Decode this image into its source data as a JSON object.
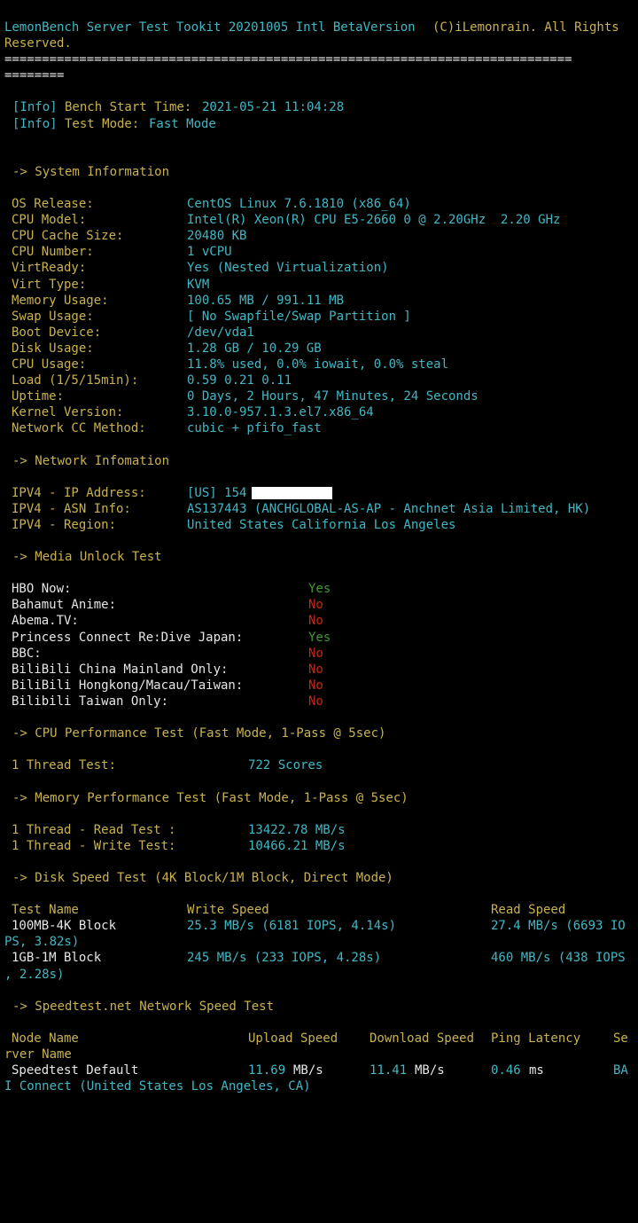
{
  "header": {
    "title": "LemonBench Server Test Tookit 20201005 Intl BetaVersion",
    "copyright_line1": "(C)iLemonrain. All Rights",
    "copyright_line2": "Reserved.",
    "separator1": "============================================================================",
    "separator2": "========"
  },
  "info": {
    "tag": "[Info]",
    "start_label": "Bench Start Time:",
    "start_value": "2021-05-21 11:04:28",
    "mode_label": "Test Mode:",
    "mode_value": "Fast Mode"
  },
  "system": {
    "heading": "-> System Information",
    "rows": [
      {
        "label": "OS Release:",
        "value": "CentOS Linux 7.6.1810 (x86_64)"
      },
      {
        "label": "CPU Model:",
        "value": "Intel(R) Xeon(R) CPU E5-2660 0 @ 2.20GHz  2.20 GHz"
      },
      {
        "label": "CPU Cache Size:",
        "value": "20480 KB"
      },
      {
        "label": "CPU Number:",
        "value": "1 vCPU"
      },
      {
        "label": "VirtReady:",
        "value": "Yes (Nested Virtualization)"
      },
      {
        "label": "Virt Type:",
        "value": "KVM"
      },
      {
        "label": "Memory Usage:",
        "value": "100.65 MB / 991.11 MB"
      },
      {
        "label": "Swap Usage:",
        "value": "[ No Swapfile/Swap Partition ]"
      },
      {
        "label": "Boot Device:",
        "value": "/dev/vda1"
      },
      {
        "label": "Disk Usage:",
        "value": "1.28 GB / 10.29 GB"
      },
      {
        "label": "CPU Usage:",
        "value": "11.8% used, 0.0% iowait, 0.0% steal"
      },
      {
        "label": "Load (1/5/15min):",
        "value": "0.59 0.21 0.11"
      },
      {
        "label": "Uptime:",
        "value": "0 Days, 2 Hours, 47 Minutes, 24 Seconds"
      },
      {
        "label": "Kernel Version:",
        "value": "3.10.0-957.1.3.el7.x86_64"
      },
      {
        "label": "Network CC Method:",
        "value": "cubic + pfifo_fast"
      }
    ]
  },
  "network": {
    "heading": "-> Network Infomation",
    "rows": [
      {
        "label": "IPV4 - IP Address:",
        "value": "[US] 154"
      },
      {
        "label": "IPV4 - ASN Info:",
        "value": "AS137443 (ANCHGLOBAL-AS-AP - Anchnet Asia Limited, HK)"
      },
      {
        "label": "IPV4 - Region:",
        "value": "United States California Los Angeles"
      }
    ]
  },
  "media": {
    "heading": "-> Media Unlock Test",
    "rows": [
      {
        "label": "HBO Now:",
        "value": "Yes",
        "color": "#3d9a2d"
      },
      {
        "label": "Bahamut Anime:",
        "value": "No",
        "color": "#c4281c"
      },
      {
        "label": "Abema.TV:",
        "value": "No",
        "color": "#c4281c"
      },
      {
        "label": "Princess Connect Re:Dive Japan:",
        "value": "Yes",
        "color": "#3d9a2d"
      },
      {
        "label": "BBC:",
        "value": "No",
        "color": "#c4281c"
      },
      {
        "label": "BiliBili China Mainland Only:",
        "value": "No",
        "color": "#c4281c"
      },
      {
        "label": "BiliBili Hongkong/Macau/Taiwan:",
        "value": "No",
        "color": "#c4281c"
      },
      {
        "label": "Bilibili Taiwan Only:",
        "value": "No",
        "color": "#c4281c"
      }
    ]
  },
  "cpu": {
    "heading": "-> CPU Performance Test (Fast Mode, 1-Pass @ 5sec)",
    "label": "1 Thread Test:",
    "value": "722 Scores"
  },
  "memory": {
    "heading": "-> Memory Performance Test (Fast Mode, 1-Pass @ 5sec)",
    "rows": [
      {
        "label": "1 Thread - Read Test :",
        "value": "13422.78 MB/s"
      },
      {
        "label": "1 Thread - Write Test:",
        "value": "10466.21 MB/s"
      }
    ]
  },
  "disk": {
    "heading": "-> Disk Speed Test (4K Block/1M Block, Direct Mode)",
    "col_name": "Test Name",
    "col_write": "Write Speed",
    "col_read": "Read Speed",
    "rows": [
      {
        "name": "100MB-4K Block",
        "write": "25.3 MB/s (6181 IOPS, 4.14s)",
        "read": "27.4 MB/s (6693 IO",
        "read_wrap": "PS, 3.82s)"
      },
      {
        "name": "1GB-1M Block",
        "write": "245 MB/s (233 IOPS, 4.28s)",
        "read": "460 MB/s (438 IOPS",
        "read_wrap": ", 2.28s)"
      }
    ]
  },
  "speedtest": {
    "heading": "-> Speedtest.net Network Speed Test",
    "col_node": "Node Name",
    "col_upload": "Upload Speed",
    "col_download": "Download Speed",
    "col_ping": "Ping Latency",
    "col_server": "Se",
    "col_server_wrap": "rver Name",
    "row": {
      "node": "Speedtest Default",
      "upload_num": "11.69",
      "upload_unit": "MB/s",
      "download_num": "11.41",
      "download_unit": "MB/s",
      "ping_num": "0.46",
      "ping_unit": "ms",
      "server": "BA",
      "server_wrap": "I Connect (United States Los Angeles, CA)"
    }
  }
}
